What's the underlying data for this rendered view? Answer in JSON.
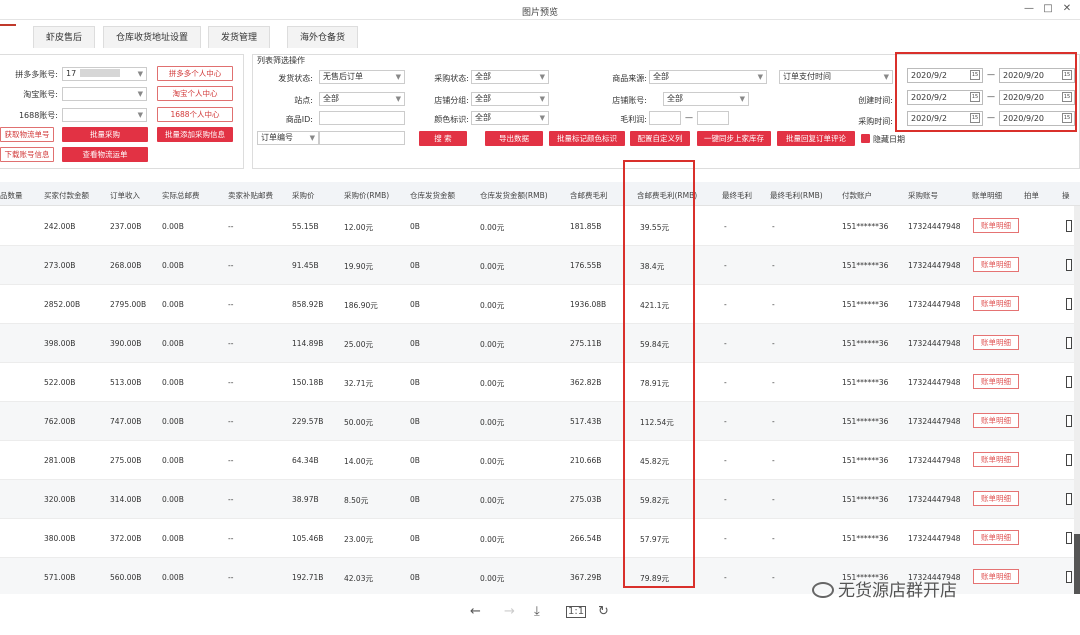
{
  "window": {
    "title": "图片预览",
    "minimize": "—",
    "maximize": "□",
    "close": "✕"
  },
  "tabs": [
    "虾皮售后",
    "仓库收货地址设置",
    "发货管理",
    "海外仓备货"
  ],
  "accounts": {
    "pdd_label": "拼多多账号:",
    "pdd_value": "17",
    "taobao_label": "淘宝账号:",
    "a1688_label": "1688账号:",
    "pdd_center": "拼多多个人中心",
    "taobao_center": "淘宝个人中心",
    "a1688_center": "1688个人中心",
    "fetch_logistics": "获取物流单号",
    "batch_purchase": "批量采购",
    "batch_add_info": "批量添加采购信息",
    "download_account": "下载账号信息",
    "check_logistics": "查看物流运单"
  },
  "filter": {
    "title": "列表筛选操作",
    "ship_status_label": "发货状态:",
    "ship_status_value": "无售后订单",
    "site_label": "站点:",
    "site_value": "全部",
    "product_id_label": "商品ID:",
    "order_no": "订单编号",
    "purchase_status_label": "采购状态:",
    "purchase_status_value": "全部",
    "shop_group_label": "店铺分组:",
    "shop_group_value": "全部",
    "color_tag_label": "颜色标识:",
    "color_tag_value": "全部",
    "source_label": "商品来源:",
    "source_value": "全部",
    "shop_account_label": "店铺账号:",
    "shop_account_value": "全部",
    "margin_label": "毛利润:",
    "range_sep": "—",
    "time_type": "订单支付时间",
    "created_label": "创建时间:",
    "purchase_time_label": "采购时间:",
    "hide_date": "隐藏日期",
    "btn_search": "搜 索",
    "btn_export": "导出数据",
    "btn_color": "批量标记颜色标识",
    "btn_custom": "配置自定义列",
    "btn_sync": "一键同步上家库存",
    "btn_review": "批量回复订单评论",
    "dates": [
      {
        "from": "2020/9/2",
        "to": "2020/9/20"
      },
      {
        "from": "2020/9/2",
        "to": "2020/9/20"
      },
      {
        "from": "2020/9/2",
        "to": "2020/9/20"
      }
    ],
    "cal_glyph": "15"
  },
  "table": {
    "headers": [
      "品数量",
      "买家付款金额",
      "订单收入",
      "实际总邮费",
      "卖家补贴邮费",
      "采购价",
      "采购价(RMB)",
      "仓库发货金额",
      "仓库发货金额(RMB)",
      "含邮费毛利",
      "含邮费毛利(RMB)",
      "最终毛利",
      "最终毛利(RMB)",
      "付款账户",
      "采购账号",
      "账单明细",
      "拍单",
      "操"
    ],
    "detail_btn": "账单明细",
    "rows": [
      [
        "242.00B",
        "237.00B",
        "0.00B",
        "--",
        "55.15B",
        "12.00元",
        "0B",
        "0.00元",
        "181.85B",
        "39.55元",
        "-",
        "-",
        "151******36",
        "17324447948"
      ],
      [
        "273.00B",
        "268.00B",
        "0.00B",
        "--",
        "91.45B",
        "19.90元",
        "0B",
        "0.00元",
        "176.55B",
        "38.4元",
        "-",
        "-",
        "151******36",
        "17324447948"
      ],
      [
        "2852.00B",
        "2795.00B",
        "0.00B",
        "--",
        "858.92B",
        "186.90元",
        "0B",
        "0.00元",
        "1936.08B",
        "421.1元",
        "-",
        "-",
        "151******36",
        "17324447948"
      ],
      [
        "398.00B",
        "390.00B",
        "0.00B",
        "--",
        "114.89B",
        "25.00元",
        "0B",
        "0.00元",
        "275.11B",
        "59.84元",
        "-",
        "-",
        "151******36",
        "17324447948"
      ],
      [
        "522.00B",
        "513.00B",
        "0.00B",
        "--",
        "150.18B",
        "32.71元",
        "0B",
        "0.00元",
        "362.82B",
        "78.91元",
        "-",
        "-",
        "151******36",
        "17324447948"
      ],
      [
        "762.00B",
        "747.00B",
        "0.00B",
        "--",
        "229.57B",
        "50.00元",
        "0B",
        "0.00元",
        "517.43B",
        "112.54元",
        "-",
        "-",
        "151******36",
        "17324447948"
      ],
      [
        "281.00B",
        "275.00B",
        "0.00B",
        "--",
        "64.34B",
        "14.00元",
        "0B",
        "0.00元",
        "210.66B",
        "45.82元",
        "-",
        "-",
        "151******36",
        "17324447948"
      ],
      [
        "320.00B",
        "314.00B",
        "0.00B",
        "--",
        "38.97B",
        "8.50元",
        "0B",
        "0.00元",
        "275.03B",
        "59.82元",
        "-",
        "-",
        "151******36",
        "17324447948"
      ],
      [
        "380.00B",
        "372.00B",
        "0.00B",
        "--",
        "105.46B",
        "23.00元",
        "0B",
        "0.00元",
        "266.54B",
        "57.97元",
        "-",
        "-",
        "151******36",
        "17324447948"
      ],
      [
        "571.00B",
        "560.00B",
        "0.00B",
        "--",
        "192.71B",
        "42.03元",
        "0B",
        "0.00元",
        "367.29B",
        "79.89元",
        "-",
        "-",
        "151******36",
        "17324447948"
      ]
    ]
  },
  "watermark": "无货源店群开店",
  "colors": {
    "accent": "#e23244",
    "highlight": "#d9302b"
  }
}
